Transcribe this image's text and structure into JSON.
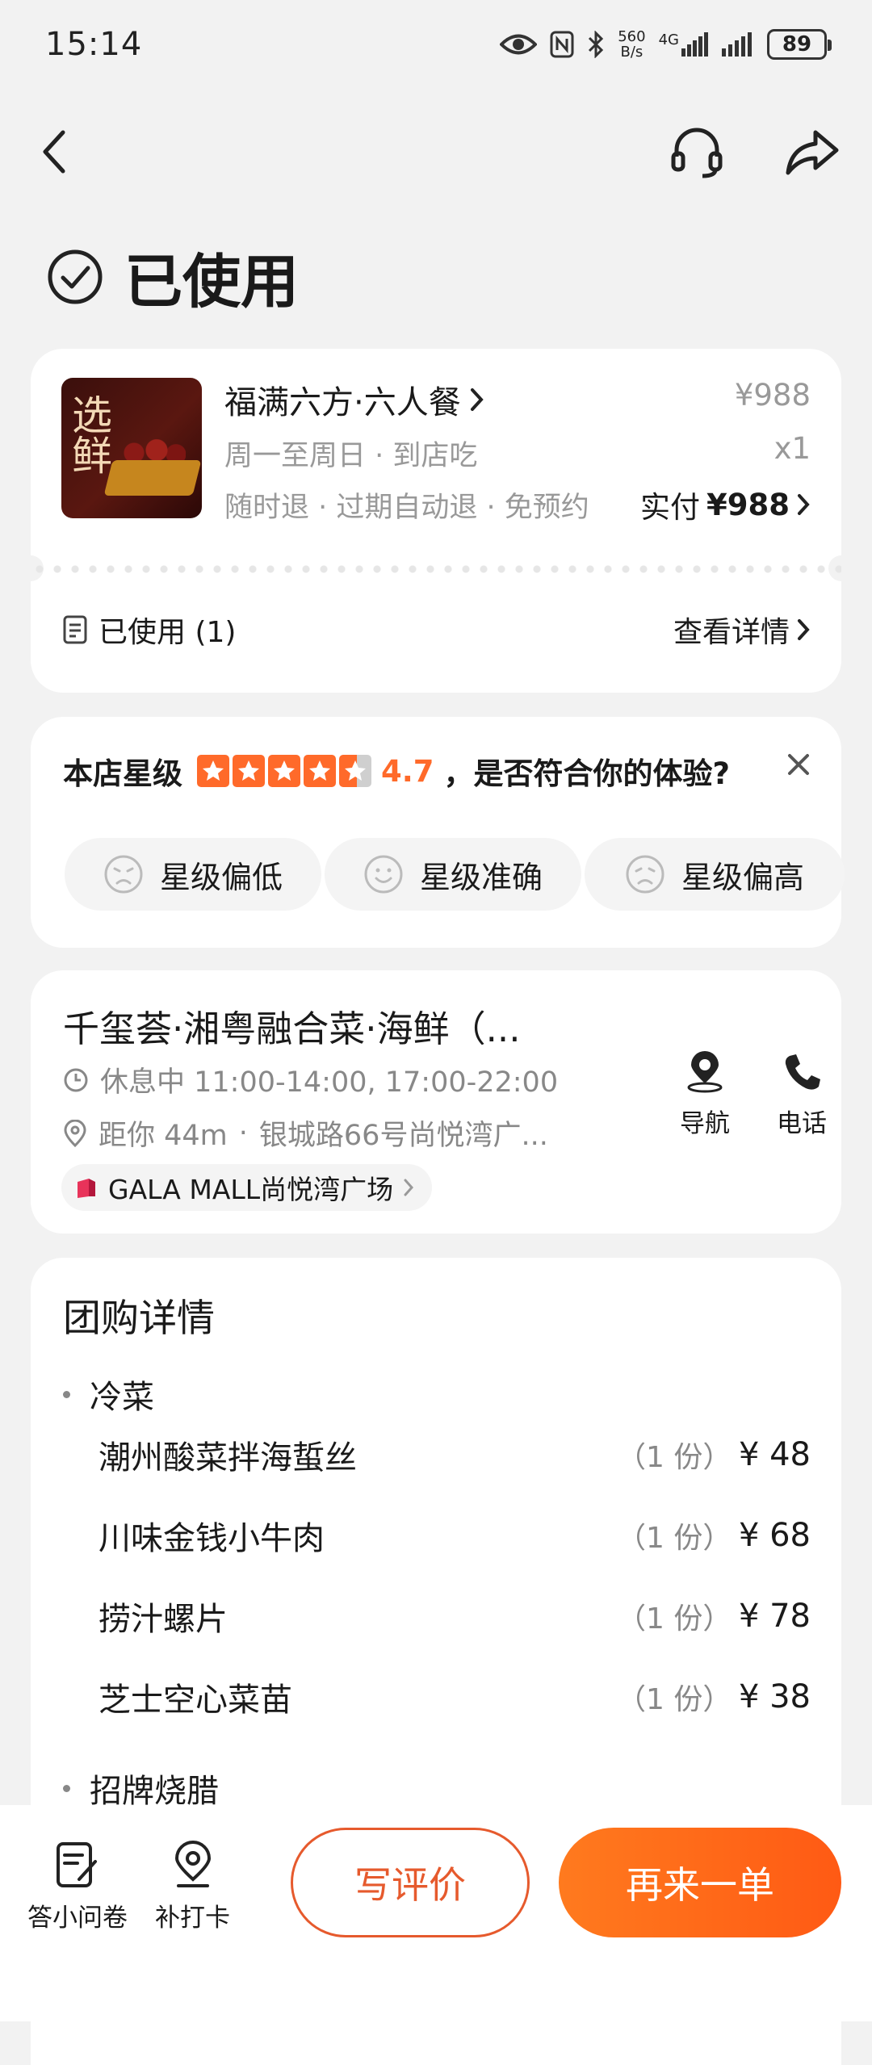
{
  "status_bar": {
    "time": "15:14",
    "net_speed_value": "560",
    "net_speed_unit": "B/s",
    "network": "4G",
    "battery": "89"
  },
  "page": {
    "status": "已使用"
  },
  "order": {
    "deal_name": "福满六方·六人餐",
    "thumb_text": "选鲜",
    "schedule": "周一至周日 · 到店吃",
    "refund_policy": "随时退 · 过期自动退 · 免预约",
    "original_price": "¥988",
    "quantity": "x1",
    "paid_label": "实付",
    "paid_amount": "¥988",
    "used_label": "已使用 (1)",
    "view_detail": "查看详情"
  },
  "rating": {
    "label": "本店星级",
    "value": "4.7",
    "question": "，是否符合你的体验?",
    "stars": 4.7,
    "options": [
      {
        "label": "星级偏低",
        "icon": "face-low-icon"
      },
      {
        "label": "星级准确",
        "icon": "face-smile-icon"
      },
      {
        "label": "星级偏高",
        "icon": "face-high-icon"
      }
    ]
  },
  "shop": {
    "name": "千玺荟·湘粤融合菜·海鲜（...",
    "hours": "休息中 11:00-14:00, 17:00-22:00",
    "distance": "距你 44m",
    "address": "银城路66号尚悦湾广...",
    "mall": "GALA MALL尚悦湾广场",
    "nav_label": "导航",
    "phone_label": "电话"
  },
  "detail": {
    "title": "团购详情",
    "section": "冷菜",
    "items": [
      {
        "name": "潮州酸菜拌海蜇丝",
        "qty": "（1 份）",
        "price": "¥ 48"
      },
      {
        "name": "川味金钱小牛肉",
        "qty": "（1 份）",
        "price": "¥ 68"
      },
      {
        "name": "捞汁螺片",
        "qty": "（1 份）",
        "price": "¥ 78"
      },
      {
        "name": "芝士空心菜苗",
        "qty": "（1 份）",
        "price": "¥ 38"
      }
    ],
    "next_section": "招牌烧腊"
  },
  "bottom_bar": {
    "survey": "答小问卷",
    "checkin": "补打卡",
    "review": "写评价",
    "reorder": "再来一单"
  },
  "colors": {
    "accent": "#ff6a2a",
    "review_border": "#e65a2d"
  }
}
